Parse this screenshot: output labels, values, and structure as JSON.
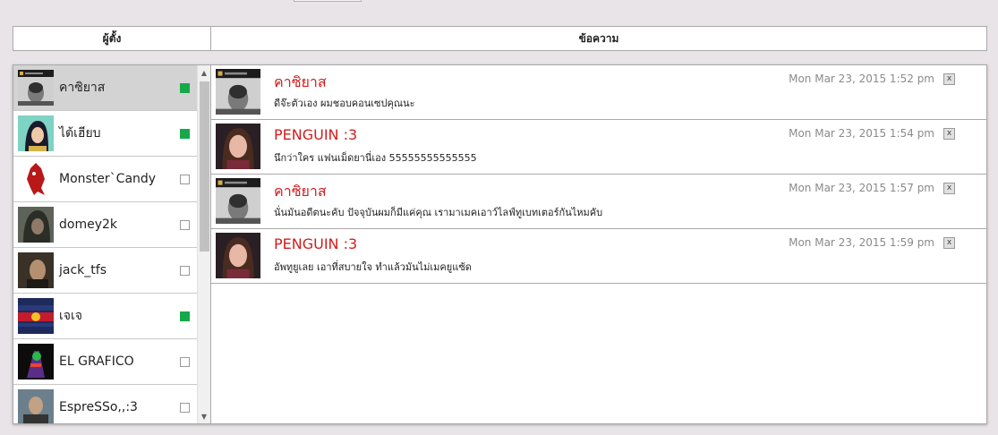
{
  "header": {
    "author_col": "ผู้ตั้ง",
    "message_col": "ข้อความ"
  },
  "users": [
    {
      "name": "คาซิยาส",
      "online": true,
      "selected": true,
      "avatar": "face-bw"
    },
    {
      "name": "ไต้เฮียบ",
      "online": true,
      "selected": false,
      "avatar": "mulan"
    },
    {
      "name": "Monster`Candy",
      "online": false,
      "selected": false,
      "avatar": "red-monster"
    },
    {
      "name": "domey2k",
      "online": false,
      "selected": false,
      "avatar": "hooded"
    },
    {
      "name": "jack_tfs",
      "online": false,
      "selected": false,
      "avatar": "man"
    },
    {
      "name": "เจเจ",
      "online": true,
      "selected": false,
      "avatar": "redbull"
    },
    {
      "name": "EL GRAFICO",
      "online": false,
      "selected": false,
      "avatar": "neon"
    },
    {
      "name": "EspreSSo,,:3",
      "online": false,
      "selected": false,
      "avatar": "man2"
    }
  ],
  "messages": [
    {
      "author": "คาซิยาส",
      "time": "Mon Mar 23, 2015 1:52 pm",
      "text": "ดีจ๊ะตัวเอง ผมชอบคอนเซปคุณนะ",
      "avatar": "face-bw"
    },
    {
      "author": "PENGUIN :3",
      "time": "Mon Mar 23, 2015 1:54 pm",
      "text": "นึกว่าใคร แฟนเม็ดยานี่เอง 55555555555555",
      "avatar": "girl"
    },
    {
      "author": "คาซิยาส",
      "time": "Mon Mar 23, 2015 1:57 pm",
      "text": "นั่นมันอดีตนะคับ ปัจจุบันผมก็มีแค่คุณ เรามาเมคเอาว์ไลฟ์ทูเบทเตอร์กันไหมคับ",
      "avatar": "face-bw"
    },
    {
      "author": "PENGUIN :3",
      "time": "Mon Mar 23, 2015 1:59 pm",
      "text": "อัพทูยูเลย เอาที่สบายใจ ทำแล้วมันไม่เมคยูแซ้ด",
      "avatar": "girl"
    }
  ],
  "delete_label": "x",
  "colors": {
    "author": "#d21c1c",
    "online": "#16a94a",
    "selected_row": "#d3d3d3"
  }
}
